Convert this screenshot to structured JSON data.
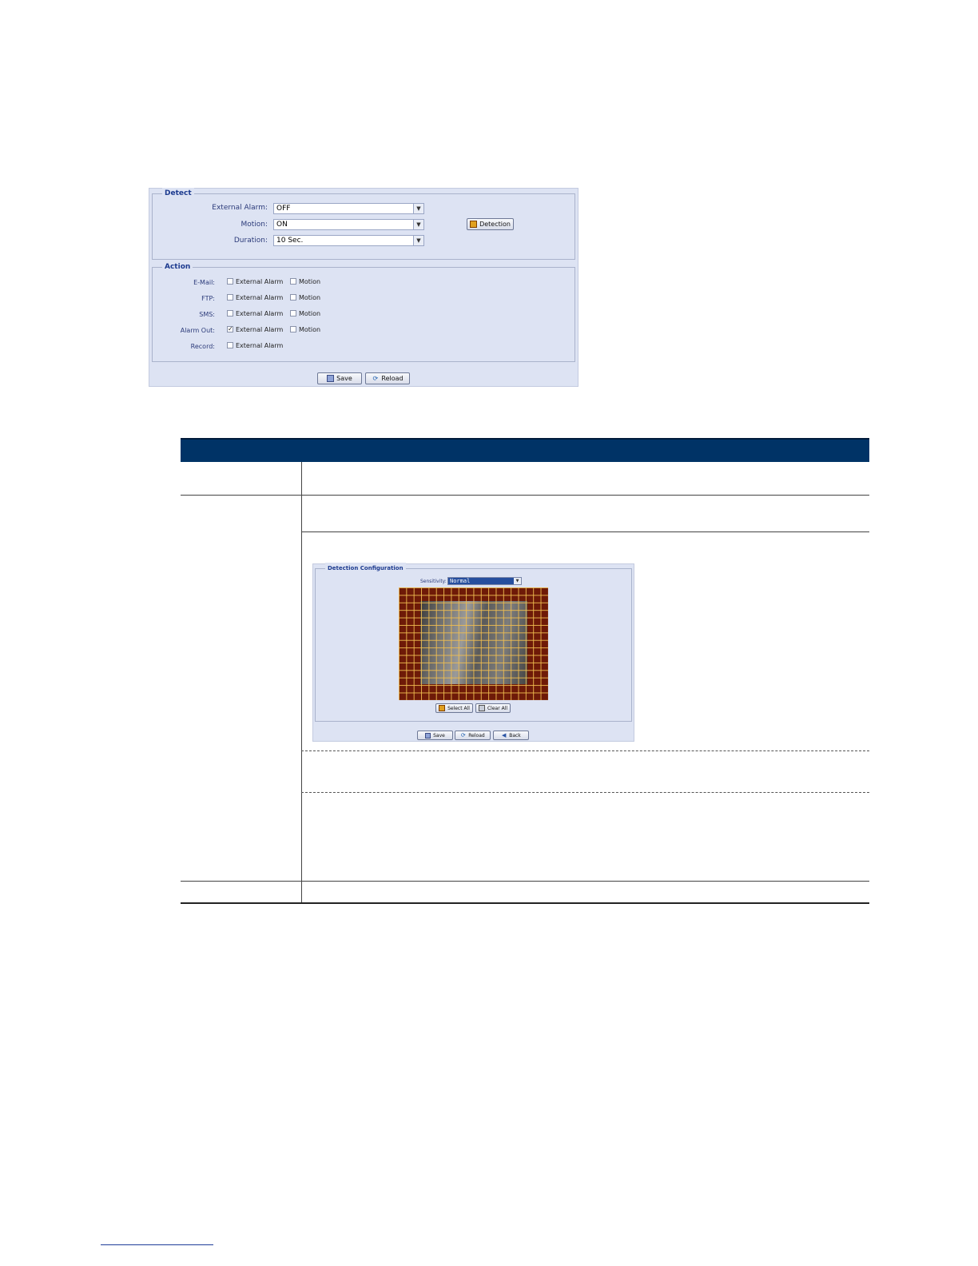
{
  "panel1": {
    "detect": {
      "legend": "Detect",
      "external_alarm": {
        "label": "External Alarm:",
        "value": "OFF"
      },
      "motion": {
        "label": "Motion:",
        "value": "ON"
      },
      "duration": {
        "label": "Duration:",
        "value": "10 Sec."
      },
      "detection_button": "Detection"
    },
    "action": {
      "legend": "Action",
      "rows": [
        {
          "label": "E-Mail:",
          "ext_label": "External Alarm",
          "ext_checked": false,
          "motion_label": "Motion",
          "motion_checked": false
        },
        {
          "label": "FTP:",
          "ext_label": "External Alarm",
          "ext_checked": false,
          "motion_label": "Motion",
          "motion_checked": false
        },
        {
          "label": "SMS:",
          "ext_label": "External Alarm",
          "ext_checked": false,
          "motion_label": "Motion",
          "motion_checked": false
        },
        {
          "label": "Alarm Out:",
          "ext_label": "External Alarm",
          "ext_checked": true,
          "motion_label": "Motion",
          "motion_checked": false
        },
        {
          "label": "Record:",
          "ext_label": "External Alarm",
          "ext_checked": false
        }
      ]
    },
    "buttons": {
      "save": "Save",
      "reload": "Reload"
    }
  },
  "panel2": {
    "legend": "Detection Configuration",
    "sensitivity": {
      "label": "Sensitivity:",
      "value": "Normal"
    },
    "select_all": "Select All",
    "clear_all": "Clear All",
    "buttons": {
      "save": "Save",
      "reload": "Reload",
      "back": "Back"
    }
  },
  "colors": {
    "panel_bg": "#dde3f3",
    "table_header": "#003366",
    "grid_cell": "#6e1a08",
    "grid_line": "#f0be50"
  }
}
